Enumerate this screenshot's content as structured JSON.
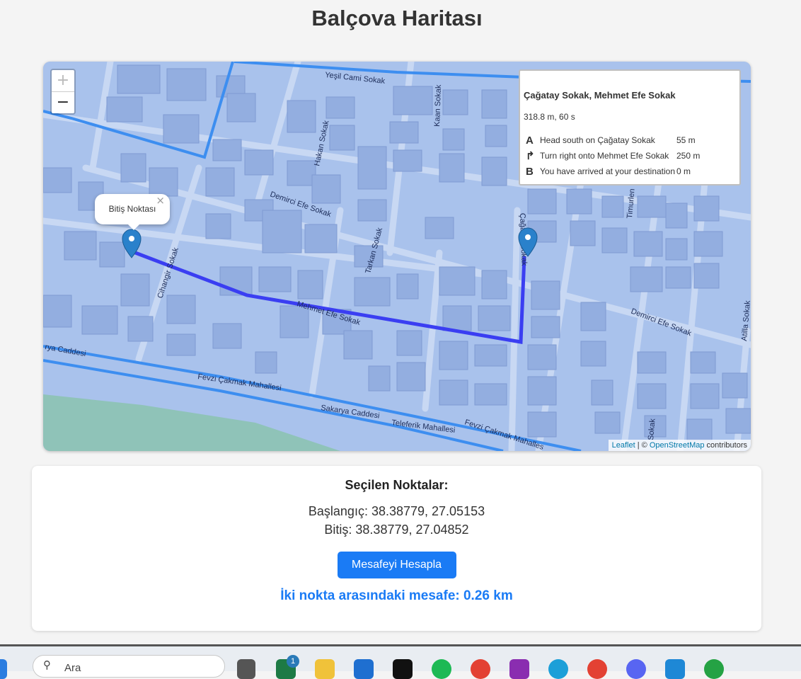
{
  "page": {
    "title": "Balçova Haritası"
  },
  "map": {
    "zoom_in_label": "+",
    "zoom_out_label": "−",
    "street_labels": {
      "yesil_cami": "Yeşil Cami Sokak",
      "demirci_efe": "Demirci Efe Sokak",
      "hakan": "Hakan Sokak",
      "kaan": "Kaan Sokak",
      "tarkan": "Tarkan Sokak",
      "cihangir": "Cihangir Sokak",
      "mehmet_efe": "Mehmet Efe Sokak",
      "cagatay": "Çağatay Sokak",
      "timurlenk": "Timurlen",
      "atilla": "Atilla Sokak",
      "sakarya": "Sakarya Caddesi",
      "sakarya_left": "rya Caddesi",
      "fevzi": "Fevzi Çakmak Mahallesi",
      "fevzi_right": "Fevzi Çakmak Mahalles",
      "teleferik": "Teleferik Mahallesi",
      "sokak_bottom": "Sokak"
    },
    "popup": {
      "text": "Bitiş Noktası",
      "close": "×"
    },
    "attribution": {
      "leaflet": "Leaflet",
      "sep": " | © ",
      "osm": "OpenStreetMap",
      "suffix": " contributors"
    },
    "route_colors": {
      "route": "#3a3ef2",
      "road": "#3d8ef0",
      "marker": "#2a81cb"
    }
  },
  "routing": {
    "name": "Çağatay Sokak, Mehmet Efe Sokak",
    "summary": "318.8 m, 60 s",
    "steps": [
      {
        "icon": "A",
        "text": "Head south on Çağatay Sokak",
        "distance": "55 m"
      },
      {
        "icon": "↱",
        "text": "Turn right onto Mehmet Efe Sokak",
        "distance": "250 m"
      },
      {
        "icon": "B",
        "text": "You have arrived at your destination",
        "distance": "0 m"
      }
    ]
  },
  "info": {
    "title": "Seçilen Noktalar:",
    "start": "Başlangıç: 38.38779, 27.05153",
    "end": "Bitiş: 38.38779, 27.04852",
    "button": "Mesafeyi Hesapla",
    "result": "İki nokta arasındaki mesafe: 0.26 km"
  },
  "taskbar": {
    "search_placeholder": "Ara",
    "badge": "1",
    "icons": [
      "windows-icon",
      "search-icon",
      "task-view-icon",
      "excel-icon",
      "file-explorer-icon",
      "store-icon",
      "netflix-icon",
      "spotify-icon",
      "chrome-icon",
      "app-icon",
      "edge-icon",
      "chrome-profile-icon",
      "discord-icon",
      "vscode-icon",
      "whatsapp-icon"
    ]
  }
}
